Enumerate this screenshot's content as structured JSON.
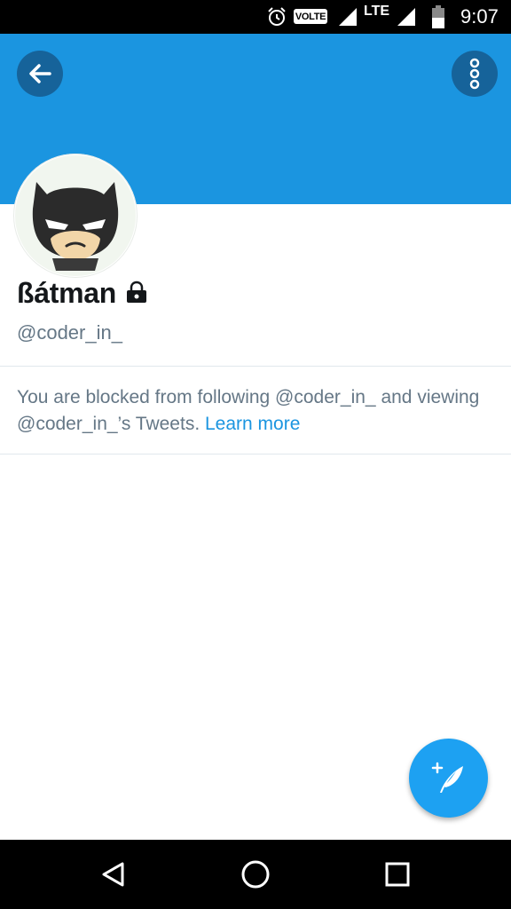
{
  "status_bar": {
    "volte": "VOLTE",
    "network": "LTE",
    "time": "9:07",
    "icons": [
      "alarm-icon",
      "signal-icon",
      "battery-icon"
    ]
  },
  "header": {
    "color": "#1b95e0",
    "back_icon": "arrow-left-icon",
    "more_icon": "more-vertical-icon"
  },
  "profile": {
    "display_name": "ßátman",
    "protected_icon": "lock-icon",
    "handle": "@coder_in_"
  },
  "blocked_notice": {
    "message": "You are blocked from following @coder_in_ and viewing @coder_in_’s Tweets.",
    "link": "Learn more"
  },
  "fab": {
    "icon": "compose-tweet-icon",
    "color": "#1da1f2"
  },
  "nav_bar": {
    "icons": [
      "back-triangle-icon",
      "home-circle-icon",
      "recents-square-icon"
    ]
  }
}
